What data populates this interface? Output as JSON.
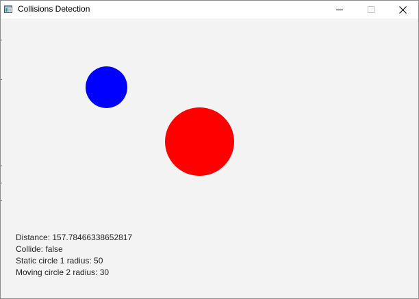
{
  "window": {
    "title": "Collisions Detection",
    "icon": "app-window-icon",
    "controls": {
      "minimize_icon": "minimize-icon",
      "maximize_icon": "maximize-icon",
      "close_icon": "close-icon"
    }
  },
  "scene": {
    "background_color": "#f3f3f3",
    "moving_circle": {
      "color": "#0000ff"
    },
    "static_circle": {
      "color": "#ff0000"
    }
  },
  "info": {
    "distance": "Distance: 157.78466338652817",
    "collide": "Collide: false",
    "static_radius": "Static circle 1 radius: 50",
    "moving_radius": "Moving circle 2 radius: 30"
  }
}
